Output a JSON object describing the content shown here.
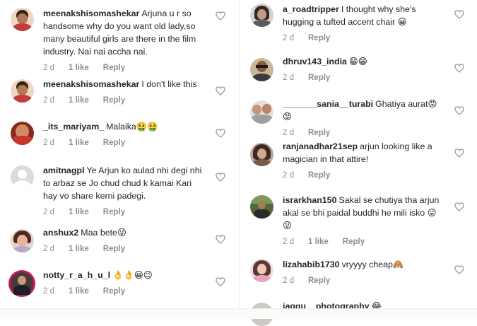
{
  "left_comments": [
    {
      "username": "meenakshisomashekar",
      "text": "Arjuna  u r so handsome why do you want old lady,so many beautiful girls are there in the film industry.  Nai nai accha nai.",
      "time": "2 d",
      "likes": "1 like",
      "reply": "Reply"
    },
    {
      "username": "meenakshisomashekar",
      "text": "I don't  like  this",
      "time": "2 d",
      "likes": "1 like",
      "reply": "Reply"
    },
    {
      "username": "_its_mariyam_",
      "text": "Malaika🤮🤮",
      "time": "2 d",
      "likes": "1 like",
      "reply": "Reply"
    },
    {
      "username": "amitnagpl",
      "text": "Ye Arjun ko aulad nhi degi nhi to arbaz se Jo chud chud k kamai Kari hay vo share kerni padegi.",
      "time": "2 d",
      "likes": "1 like",
      "reply": "Reply"
    },
    {
      "username": "anshux2",
      "text": "Maa bete😜",
      "time": "2 d",
      "likes": "1 like",
      "reply": "Reply"
    },
    {
      "username": "notty_r_a_h_u_l",
      "text": "👌👌😀😉",
      "time": "2 d",
      "likes": "1 like",
      "reply": "Reply"
    }
  ],
  "right_comments": [
    {
      "username": "a_roadtripper",
      "text": "I thought why she's hugging a tufted accent chair 😀",
      "time": "2 d",
      "likes": "",
      "reply": "Reply"
    },
    {
      "username": "dhruv143_india",
      "text": "😁😁",
      "time": "2 d",
      "likes": "",
      "reply": "Reply"
    },
    {
      "username": "_______sania__turabi",
      "text": "Ghatiya aurat😡😡",
      "time": "2 d",
      "likes": "",
      "reply": "Reply"
    },
    {
      "username": "ranjanadhar21sep",
      "text": "arjun looking like a magician in that attire!",
      "time": "2 d",
      "likes": "",
      "reply": "Reply"
    },
    {
      "username": "israrkhan150",
      "text": "Sakal se chutiya tha arjun akal se bhi paidal buddhi he mili isko 😜😜",
      "time": "2 d",
      "likes": "1 like",
      "reply": "Reply"
    },
    {
      "username": "lizahabib1730",
      "text": "vryyyy cheap🙈",
      "time": "2 d",
      "likes": "",
      "reply": "Reply"
    },
    {
      "username": "jaggu__photography",
      "text": "😂",
      "time": "",
      "likes": "",
      "reply": ""
    }
  ],
  "icons": {
    "like": "heart-outline-icon"
  },
  "colors": {
    "meta": "#8e8e8e",
    "text": "#262626",
    "heart": "#8e8e8e"
  }
}
